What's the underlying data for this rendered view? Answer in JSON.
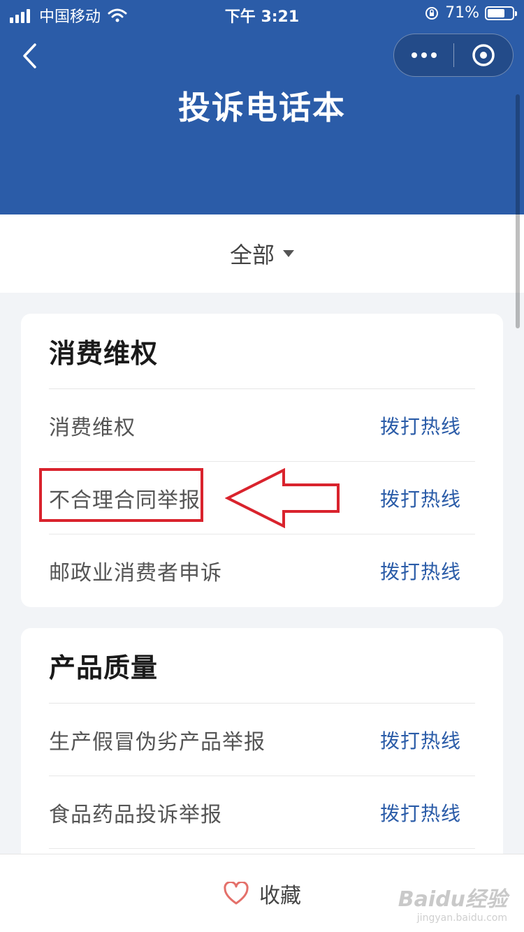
{
  "status_bar": {
    "carrier": "中国移动",
    "time": "下午 3:21",
    "battery_pct": "71%",
    "battery_level": 0.71
  },
  "header": {
    "title": "投诉电话本"
  },
  "filter": {
    "label": "全部"
  },
  "sections": [
    {
      "title": "消费维权",
      "rows": [
        {
          "name": "消费维权",
          "action": "拨打热线"
        },
        {
          "name": "不合理合同举报",
          "action": "拨打热线"
        },
        {
          "name": "邮政业消费者申诉",
          "action": "拨打热线"
        }
      ]
    },
    {
      "title": "产品质量",
      "rows": [
        {
          "name": "生产假冒伪劣产品举报",
          "action": "拨打热线"
        },
        {
          "name": "食品药品投诉举报",
          "action": "拨打热线"
        }
      ]
    }
  ],
  "bottom": {
    "favorite_label": "收藏"
  },
  "watermark": {
    "brand": "Baidu经验",
    "url": "jingyan.baidu.com"
  },
  "colors": {
    "header_bg": "#2b5ca8",
    "accent": "#2b5ca8",
    "annotation": "#d9232d",
    "heart": "#e4706a"
  }
}
